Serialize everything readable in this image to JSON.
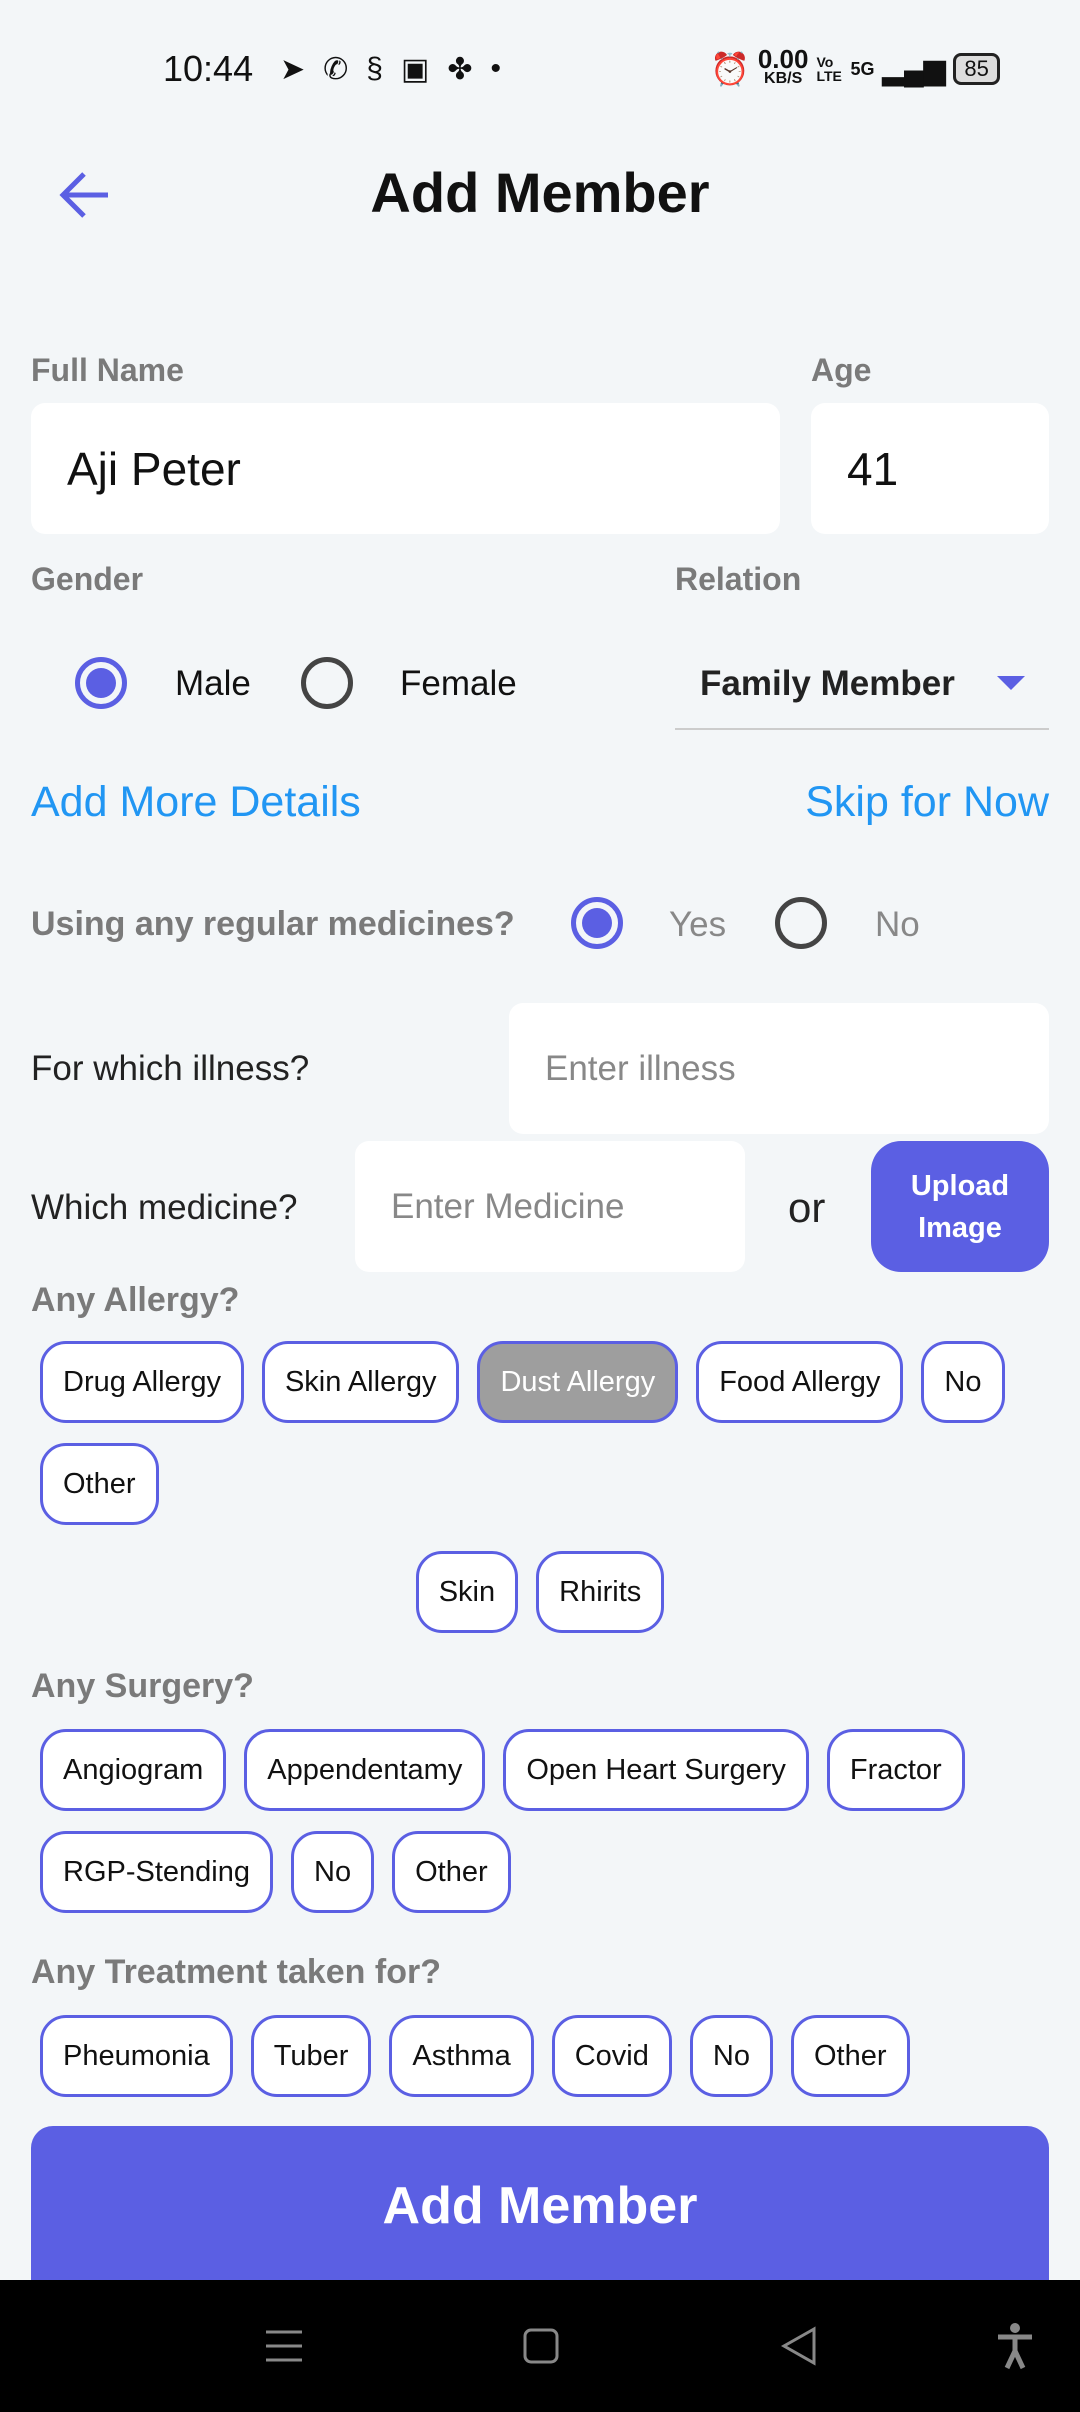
{
  "status_bar": {
    "time": "10:44",
    "net_speed": "0.00",
    "net_unit": "KB/S",
    "volte": "Vo LTE",
    "network": "5G",
    "battery": "85"
  },
  "header": {
    "title": "Add Member",
    "back_icon": "arrow-left-icon"
  },
  "form": {
    "full_name_label": "Full Name",
    "full_name_value": "Aji Peter",
    "age_label": "Age",
    "age_value": "41",
    "gender_label": "Gender",
    "gender_options": [
      "Male",
      "Female"
    ],
    "gender_selected": "Male",
    "relation_label": "Relation",
    "relation_value": "Family Member",
    "add_more_details": "Add More Details",
    "skip_for_now": "Skip for Now",
    "medicines_question": "Using any regular medicines?",
    "medicines_options": [
      "Yes",
      "No"
    ],
    "medicines_selected": "Yes",
    "illness_label": "For which illness?",
    "illness_placeholder": "Enter illness",
    "medicine_label": "Which medicine?",
    "medicine_placeholder": "Enter Medicine",
    "or_text": "or",
    "upload_image": "Upload Image",
    "allergy_label": "Any Allergy?",
    "allergy_chips": [
      "Drug Allergy",
      "Skin Allergy",
      "Dust Allergy",
      "Food Allergy",
      "No",
      "Other"
    ],
    "allergy_selected": "Dust Allergy",
    "allergy_sub_chips": [
      "Skin",
      "Rhirits"
    ],
    "surgery_label": "Any Surgery?",
    "surgery_chips": [
      "Angiogram",
      "Appendentamy",
      "Open Heart Surgery",
      "Fractor",
      "RGP-Stending",
      "No",
      "Other"
    ],
    "treatment_label": "Any Treatment taken for?",
    "treatment_chips": [
      "Pheumonia",
      "Tuber",
      "Asthma",
      "Covid",
      "No",
      "Other"
    ],
    "submit": "Add Member"
  },
  "colors": {
    "accent": "#5b5fe3",
    "link": "#2196f3",
    "selected_chip": "#9e9e9e",
    "background": "#f3f6f8"
  }
}
